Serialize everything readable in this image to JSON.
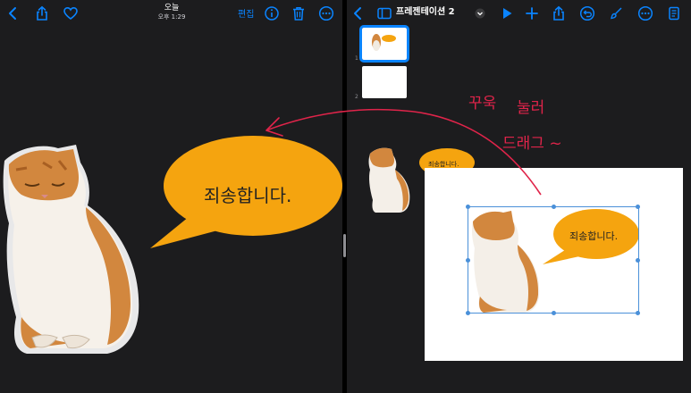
{
  "photos": {
    "title": "오늘",
    "subtitle": "오후 1:29",
    "edit_label": "편집",
    "bubble_text": "죄송합니다."
  },
  "keynote": {
    "doc_title": "프레젠테이션 2",
    "slide_numbers": [
      "1",
      "2"
    ],
    "bubble_text": "죄송합니다."
  },
  "annotation": {
    "line1a": "꾸욱",
    "line1b": "눌러",
    "line2": "드래그 ~",
    "color": "#e0244a"
  },
  "colors": {
    "accent": "#0a84ff",
    "bubble": "#f5a40f",
    "selection": "#4a90d9"
  },
  "icons": {
    "left_toolbar": [
      "chevron-left-icon",
      "share-icon",
      "heart-icon",
      "info-icon",
      "trash-icon",
      "more-icon"
    ],
    "right_toolbar": [
      "chevron-left-icon",
      "sidebar-icon",
      "play-icon",
      "plus-icon",
      "share-icon",
      "undo-icon",
      "format-brush-icon",
      "more-icon",
      "document-icon"
    ]
  }
}
